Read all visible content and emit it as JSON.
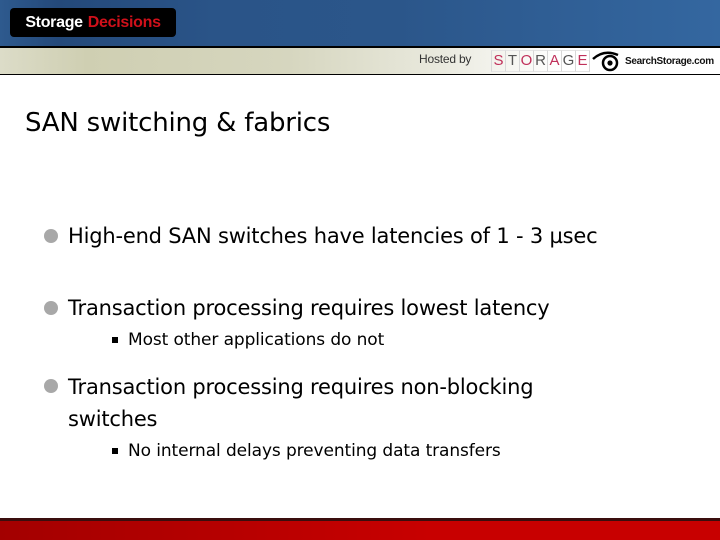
{
  "header": {
    "logo": {
      "word1": "Storage",
      "word2": "Decisions"
    },
    "hosted_by_label": "Hosted by",
    "storage_logo_letters": [
      "S",
      "T",
      "O",
      "R",
      "A",
      "G",
      "E"
    ],
    "storage_logo_colors": [
      "#c0305a",
      "#555555",
      "#c0305a",
      "#555555",
      "#c0305a",
      "#555555",
      "#c0305a"
    ],
    "search_storage_label": "SearchStorage.com",
    "search_storage_icon": "eye-icon"
  },
  "slide": {
    "title": "SAN switching & fabrics",
    "bullets": [
      {
        "text": "High-end SAN switches have latencies of 1 - 3 µsec",
        "sub": []
      },
      {
        "text": "Transaction processing requires lowest latency",
        "sub": [
          "Most other applications do not"
        ]
      },
      {
        "text": "Transaction processing requires non-blocking switches",
        "sub": [
          "No internal delays preventing data transfers"
        ]
      }
    ]
  },
  "colors": {
    "header_blue": "#2b568a",
    "brand_red": "#d0101a",
    "footer_red": "#c80000",
    "bullet_gray": "#a8a8a8"
  }
}
